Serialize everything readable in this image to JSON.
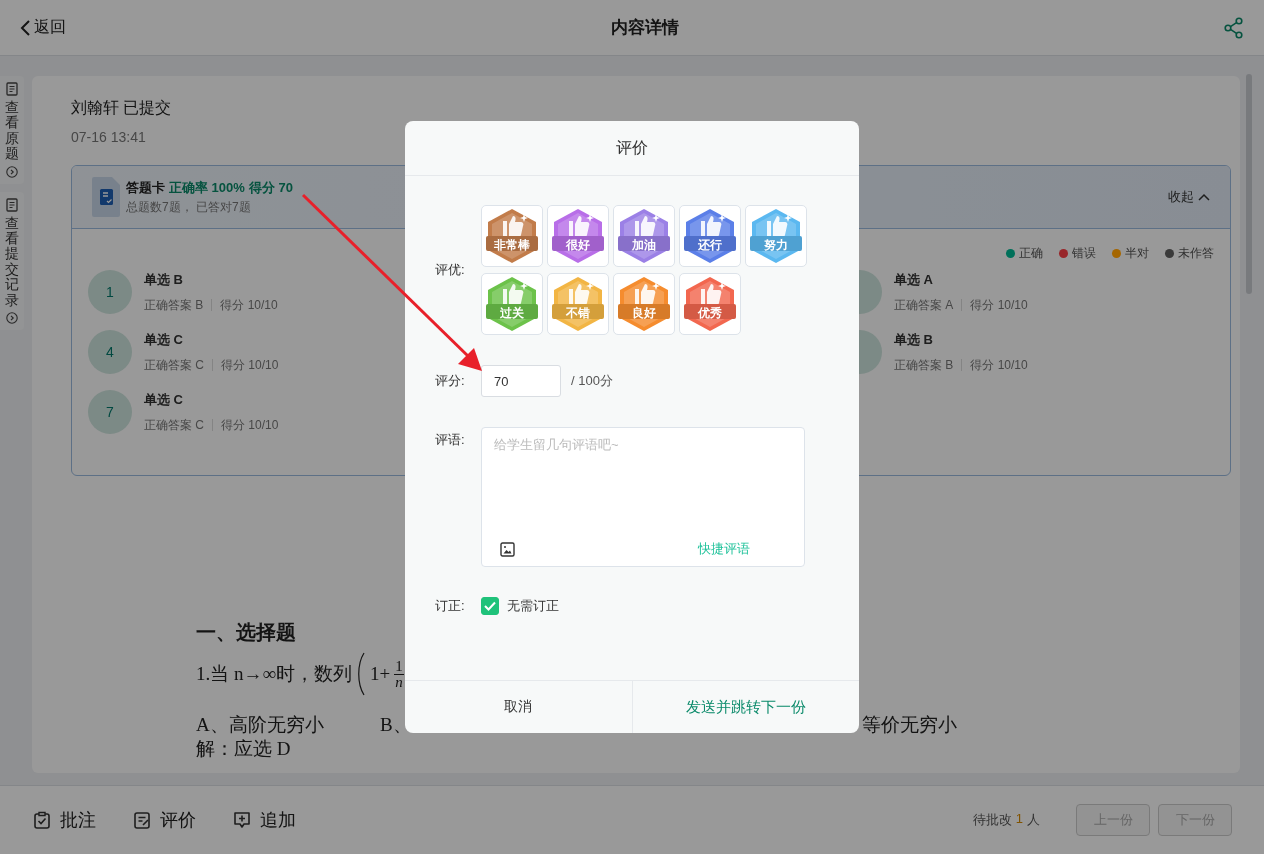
{
  "header": {
    "back": "返回",
    "title": "内容详情"
  },
  "side_tabs": [
    {
      "label": "查看原题"
    },
    {
      "label": "查看提交记录"
    }
  ],
  "submission": {
    "student": "刘翰轩 已提交",
    "time": "07-16 13:41"
  },
  "answer_card": {
    "title": "答题卡",
    "accuracy": "正确率 100%",
    "score": "得分 70",
    "summary": "总题数7题，  已答对7题",
    "collapse": "收起",
    "expanded": true,
    "legend": [
      {
        "label": "正确",
        "color": "#00705a"
      },
      {
        "label": "错误",
        "color": "#98262a"
      },
      {
        "label": "半对",
        "color": "#a56600"
      },
      {
        "label": "未作答",
        "color": "#3a3a3a"
      }
    ],
    "left_column": [
      {
        "number": "1",
        "type": "单选 B",
        "answer": "正确答案 B",
        "score": "得分 10/10"
      },
      {
        "number": "4",
        "type": "单选 C",
        "answer": "正确答案 C",
        "score": "得分 10/10"
      },
      {
        "number": "7",
        "type": "单选 C",
        "answer": "正确答案 C",
        "score": "得分 10/10"
      }
    ],
    "right_column": [
      {
        "type": "单选 A",
        "answer": "正确答案 A",
        "score": "得分 10/10"
      },
      {
        "type": "单选 B",
        "answer": "正确答案 B",
        "score": "得分 10/10"
      }
    ]
  },
  "question": {
    "section_title": "一、选择题",
    "stem": "1.当 n→∞时，数列",
    "formula_lead": "1+",
    "numerator": "1",
    "denominator": "n",
    "options": [
      "A、高阶无穷小",
      "B、"
    ],
    "option_fragment": "等价无穷小",
    "solution": "解：应选 D"
  },
  "dialog": {
    "title": "评价",
    "award_label": "评优:",
    "awards": [
      {
        "label": "非常棒",
        "color": "#c27c4a",
        "selected": false
      },
      {
        "label": "很好",
        "color": "#b86ee8",
        "selected": false
      },
      {
        "label": "加油",
        "color": "#9b80e6",
        "selected": false
      },
      {
        "label": "还行",
        "color": "#5b7fe8",
        "selected": false
      },
      {
        "label": "努力",
        "color": "#5bb8f0",
        "selected": false
      },
      {
        "label": "过关",
        "color": "#6cc24a",
        "selected": false
      },
      {
        "label": "不错",
        "color": "#f2b544",
        "selected": false
      },
      {
        "label": "良好",
        "color": "#f58c2e",
        "selected": false
      },
      {
        "label": "优秀",
        "color": "#f2674f",
        "selected": false
      }
    ],
    "score_label": "评分:",
    "score_value": "70",
    "score_max": "/ 100分",
    "comment_label": "评语:",
    "comment_placeholder": "给学生留几句评语吧~",
    "quick_comment": "快捷评语",
    "correction_label": "订正:",
    "correction_option": "无需订正",
    "correction_checked": true,
    "cancel": "取消",
    "confirm": "发送并跳转下一份"
  },
  "bottom_bar": {
    "tools": [
      {
        "label": "批注",
        "kind": "annotate"
      },
      {
        "label": "评价",
        "kind": "review"
      },
      {
        "label": "追加",
        "kind": "add"
      }
    ],
    "pending_prefix": "待批改",
    "pending_count": "1",
    "pending_suffix": "人",
    "nav": [
      {
        "label": "上一份",
        "disabled": true
      },
      {
        "label": "下一份",
        "disabled": true
      }
    ]
  }
}
